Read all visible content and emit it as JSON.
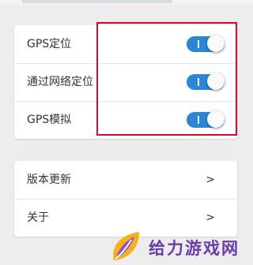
{
  "settings": {
    "items": [
      {
        "label": "GPS定位",
        "enabled": true,
        "icon": "toggle-switch"
      },
      {
        "label": "通过网络定位",
        "enabled": true,
        "icon": "toggle-switch"
      },
      {
        "label": "GPS模拟",
        "enabled": true,
        "icon": "toggle-switch"
      }
    ]
  },
  "about": {
    "items": [
      {
        "label": "版本更新",
        "arrow": ">"
      },
      {
        "label": "关于",
        "arrow": ">"
      }
    ]
  },
  "annotation": {
    "color": "#c8102e"
  },
  "watermark": {
    "text": "给力游戏网",
    "icon": "leaf-logo-icon"
  },
  "colors": {
    "toggle_on": "#2b87d6",
    "background": "#ededed"
  }
}
